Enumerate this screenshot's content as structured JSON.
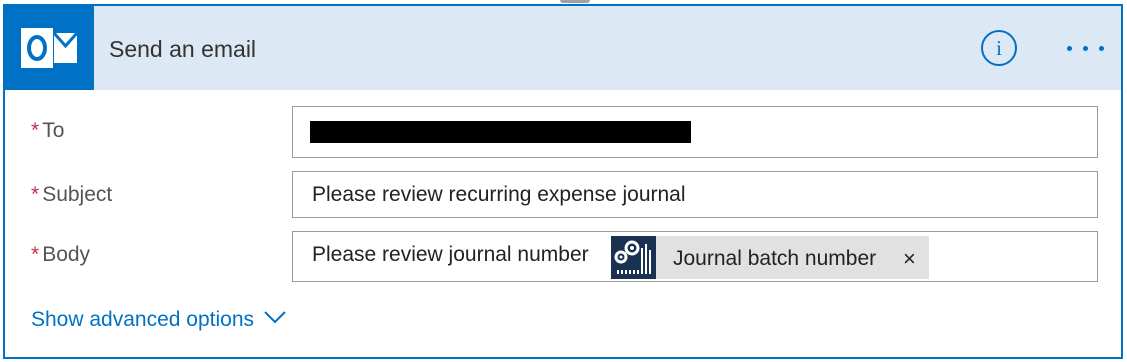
{
  "action": {
    "title": "Send an email",
    "app_icon": "outlook-icon",
    "info_label": "i",
    "more_icon": "more-options-icon"
  },
  "fields": {
    "to": {
      "required_mark": "*",
      "label": "To",
      "value": ""
    },
    "subject": {
      "required_mark": "*",
      "label": "Subject",
      "value": "Please review recurring expense journal"
    },
    "body": {
      "required_mark": "*",
      "label": "Body",
      "value": "Please review journal number",
      "token": {
        "label": "Journal batch number",
        "remove": "×",
        "icon": "dynamics-connector-icon"
      }
    }
  },
  "advanced": {
    "label": "Show advanced options",
    "icon": "chevron-down-icon"
  },
  "colors": {
    "accent": "#0072c6",
    "header_bg": "#dce8f4",
    "required": "#c4314b",
    "token_icon_bg": "#1a3152"
  }
}
